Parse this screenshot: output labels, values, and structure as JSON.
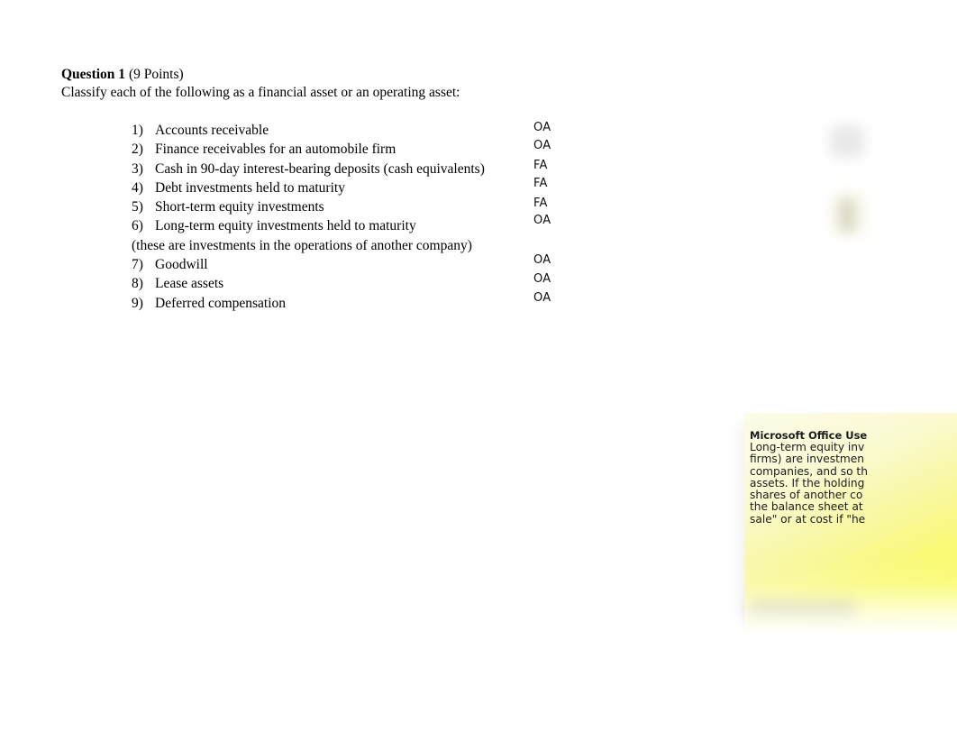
{
  "document": {
    "question": {
      "title": "Question 1",
      "points": "(9 Points)",
      "instruction": "Classify each of the following as a financial asset or an operating asset:"
    },
    "items": [
      {
        "num": "1)",
        "text": "Accounts receivable",
        "answer": "OA"
      },
      {
        "num": "2)",
        "text": "Finance receivables for an automobile firm",
        "answer": "OA"
      },
      {
        "num": "3)",
        "text": "Cash in 90-day interest-bearing deposits (cash equivalents)",
        "answer": "FA"
      },
      {
        "num": "4)",
        "text": "Debt investments held to maturity",
        "answer": "FA"
      },
      {
        "num": "5)",
        "text": "Short-term equity investments",
        "answer": "FA"
      },
      {
        "num": "6)",
        "text": "Long-term equity investments held to maturity",
        "answer": "OA"
      },
      {
        "num": "7)",
        "text": "Goodwill",
        "answer": "OA"
      },
      {
        "num": "8)",
        "text": "Lease assets",
        "answer": "OA"
      },
      {
        "num": "9)",
        "text": "Deferred compensation",
        "answer": "OA"
      }
    ],
    "item6_note": "(these are investments in the operations of another company)"
  },
  "comment_note": {
    "title": "Microsoft Office Use",
    "lines": [
      "Long-term equity inv",
      "firms) are investmen",
      "companies, and so th",
      "assets. If the holding",
      "shares of another co",
      "the balance sheet at",
      "sale\" or at cost if \"he"
    ]
  },
  "colors": {
    "page_background": "#ffffff",
    "text": "#000000",
    "note_yellow": "#fcfc63",
    "note_pale": "#fbfbe8",
    "answer_text": "#111111"
  }
}
